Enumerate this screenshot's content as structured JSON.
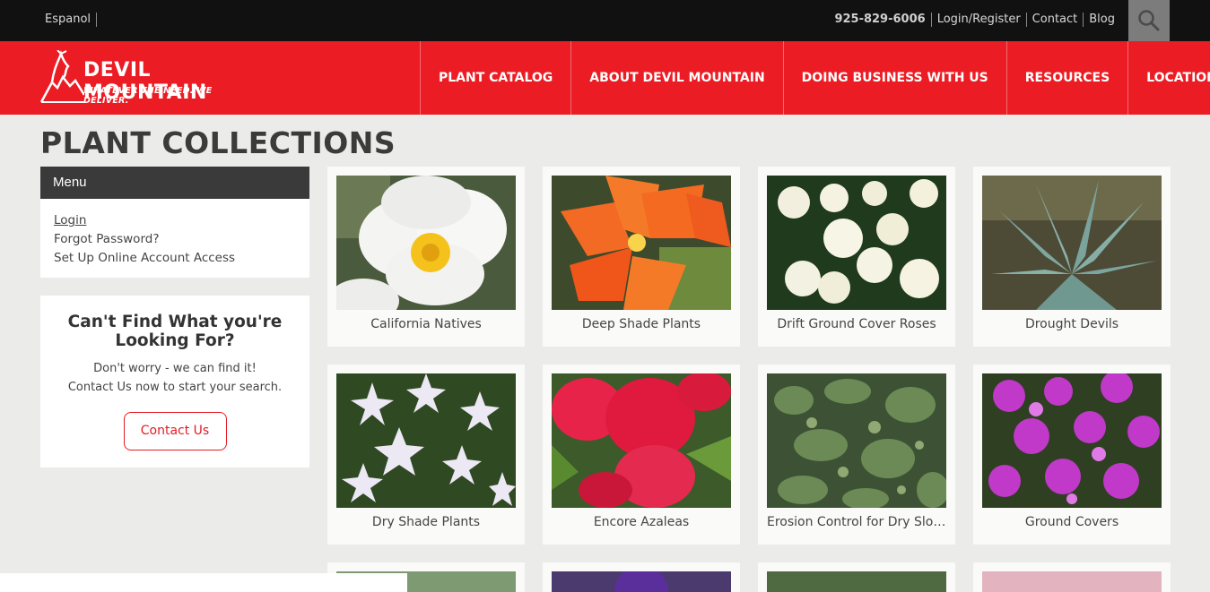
{
  "topbar": {
    "language": "Espanol",
    "phone": "925-829-6006",
    "login_register": "Login/Register",
    "contact": "Contact",
    "blog": "Blog",
    "search_icon": "search-icon"
  },
  "brand": {
    "name": "DEVIL MOUNTAIN",
    "tagline": "WHATEVER THE NEED. WE DELIVER.",
    "color": "#ec1c24"
  },
  "nav": [
    "PLANT CATALOG",
    "ABOUT DEVIL MOUNTAIN",
    "DOING BUSINESS WITH US",
    "RESOURCES",
    "LOCATIONS"
  ],
  "page": {
    "title": "PLANT COLLECTIONS"
  },
  "sidebar": {
    "menu_title": "Menu",
    "links": [
      "Login",
      "Forgot Password?",
      "Set Up Online Account Access"
    ],
    "find": {
      "title": "Can't Find What you're Looking For?",
      "line1": "Don't worry - we can find it!",
      "line2": "Contact Us now to start your search.",
      "button": "Contact Us"
    }
  },
  "collections": [
    {
      "label": "California Natives",
      "icon": "white-poppy-image"
    },
    {
      "label": "Deep Shade Plants",
      "icon": "orange-clivia-image"
    },
    {
      "label": "Drift Ground Cover Roses",
      "icon": "white-rose-image"
    },
    {
      "label": "Drought Devils",
      "icon": "agave-image"
    },
    {
      "label": "Dry Shade Plants",
      "icon": "starflower-image"
    },
    {
      "label": "Encore Azaleas",
      "icon": "red-azalea-image"
    },
    {
      "label": "Erosion Control for Dry Slopes",
      "icon": "groundcover-shrub-image"
    },
    {
      "label": "Ground Covers",
      "icon": "purple-phlox-image"
    }
  ]
}
